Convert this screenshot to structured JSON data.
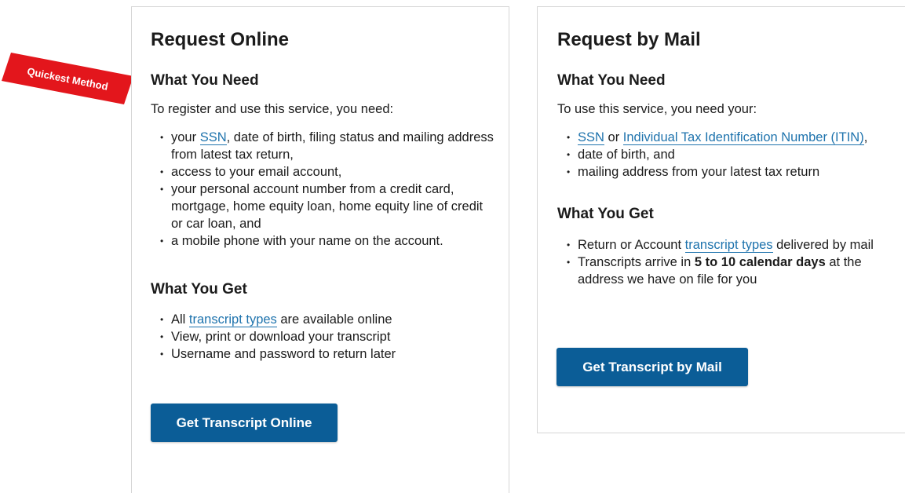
{
  "ribbon": {
    "label": "Quickest Method",
    "color": "#e3161c"
  },
  "online": {
    "title": "Request Online",
    "need_heading": "What You Need",
    "need_intro": "To register and use this service, you need:",
    "need_items": [
      {
        "pre": "your ",
        "link": "SSN",
        "post": ", date of birth, filing status and mailing address from latest tax return,"
      },
      {
        "text": "access to your email account,"
      },
      {
        "text": "your personal account number from a credit card, mortgage, home equity loan, home equity line of credit or car loan, and"
      },
      {
        "text": "a mobile phone with your name on the account."
      }
    ],
    "get_heading": "What You Get",
    "get_items": [
      {
        "pre": "All ",
        "link": "transcript types",
        "post": " are available online"
      },
      {
        "text": "View, print or download your transcript"
      },
      {
        "text": "Username and password to return later"
      }
    ],
    "button": "Get Transcript Online"
  },
  "mail": {
    "title": "Request by Mail",
    "need_heading": "What You Need",
    "need_intro": "To use this service, you need your:",
    "need_items": [
      {
        "link": "SSN",
        "mid": " or ",
        "link2": "Individual Tax Identification Number (ITIN)",
        "post": ","
      },
      {
        "text": "date of birth, and"
      },
      {
        "text": "mailing address from your latest tax return"
      }
    ],
    "get_heading": "What You Get",
    "get_items": [
      {
        "pre": "Return or Account ",
        "link": "transcript types",
        "post": " delivered by mail"
      },
      {
        "pre": "Transcripts arrive in ",
        "bold": "5 to 10 calendar days",
        "post": " at the address we have on file for you"
      }
    ],
    "button": "Get Transcript by Mail"
  },
  "colors": {
    "link": "#1e73ad",
    "button": "#0b5d97",
    "border": "#d6d6d6"
  }
}
